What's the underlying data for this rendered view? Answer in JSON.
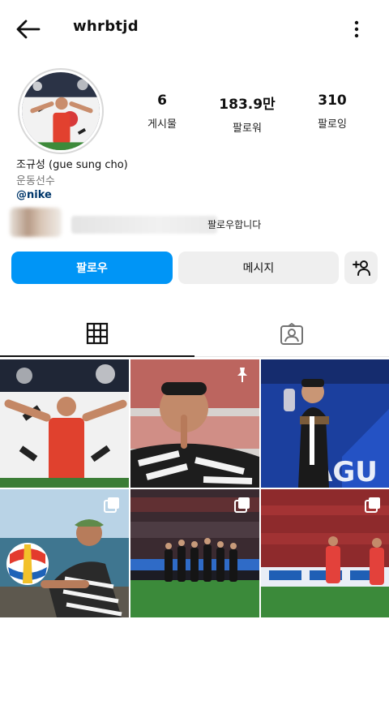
{
  "header": {
    "username": "whrbtjd"
  },
  "stats": [
    {
      "value": "6",
      "label": "게시물"
    },
    {
      "value": "183.9만",
      "label": "팔로워"
    },
    {
      "value": "310",
      "label": "팔로잉"
    }
  ],
  "bio": {
    "name": "조규성 (gue sung cho)",
    "category": "운동선수",
    "link": "@nike"
  },
  "followed_by": {
    "text": "팔로우합니다"
  },
  "actions": {
    "follow": "팔로우",
    "message": "메시지"
  },
  "tabs": {
    "active": "grid-icon",
    "items": [
      "grid-icon",
      "tagged-icon"
    ]
  },
  "posts": [
    {
      "badge": "none"
    },
    {
      "badge": "pin-icon"
    },
    {
      "badge": "none"
    },
    {
      "badge": "multiple-icon"
    },
    {
      "badge": "multiple-icon"
    },
    {
      "badge": "multiple-icon"
    }
  ],
  "colors": {
    "accent": "#0095f6",
    "secondary_button": "#efefef",
    "link": "#00376b"
  }
}
